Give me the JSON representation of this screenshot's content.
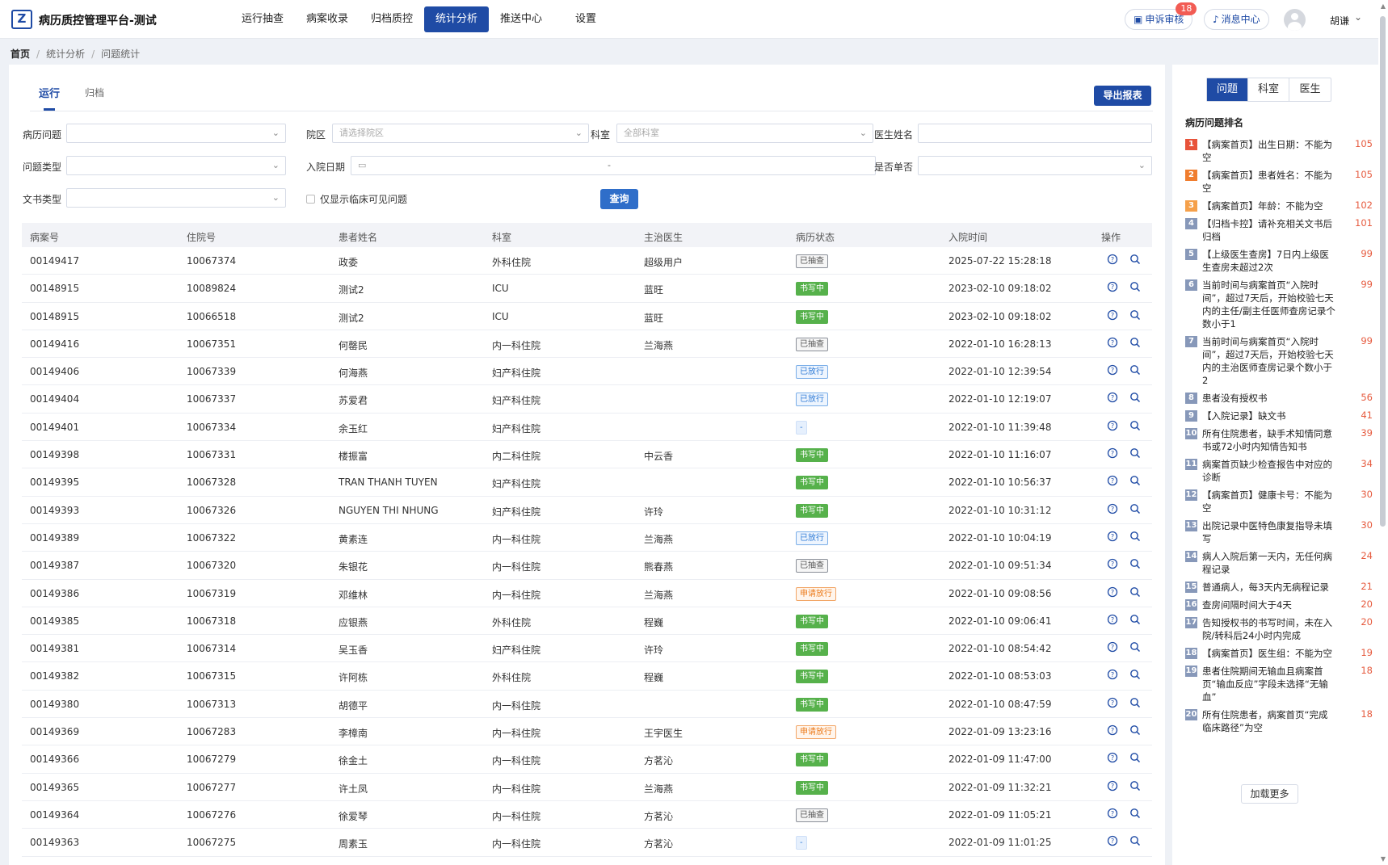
{
  "app": {
    "logo": "Z",
    "title": "病历质控管理平台-测试"
  },
  "nav": [
    "运行抽查",
    "病案收录",
    "归档质控",
    "统计分析",
    "推送中心",
    "设置"
  ],
  "header": {
    "complaint": "申诉审核",
    "complaint_badge": "18",
    "messages": "消息中心",
    "user": "胡谦"
  },
  "breadcrumb": [
    "首页",
    "统计分析",
    "问题统计"
  ],
  "tabs": [
    "运行",
    "归档"
  ],
  "export_label": "导出报表",
  "filters": {
    "record_issue": "病历问题",
    "campus": "院区",
    "campus_placeholder": "请选择院区",
    "dept": "科室",
    "dept_placeholder": "全部科室",
    "doctor": "医生姓名",
    "issue_type": "问题类型",
    "admit_date": "入院日期",
    "date_sep": "-",
    "single_veto": "是否单否",
    "doc_type": "文书类型",
    "clinical_only": "仅显示临床可见问题",
    "query": "查询"
  },
  "columns": [
    "病案号",
    "住院号",
    "患者姓名",
    "科室",
    "主治医生",
    "病历状态",
    "入院时间",
    "操作"
  ],
  "rows": [
    {
      "case": "00149417",
      "inp": "10067374",
      "name": "政委",
      "dept": "外科住院",
      "doc": "超级用户",
      "status": "已抽查",
      "st": "gray",
      "time": "2025-07-22 15:28:18"
    },
    {
      "case": "00148915",
      "inp": "10089824",
      "name": "测试2",
      "dept": "ICU",
      "doc": "蓝旺",
      "status": "书写中",
      "st": "green",
      "time": "2023-02-10 09:18:02"
    },
    {
      "case": "00148915",
      "inp": "10066518",
      "name": "测试2",
      "dept": "ICU",
      "doc": "蓝旺",
      "status": "书写中",
      "st": "green",
      "time": "2023-02-10 09:18:02"
    },
    {
      "case": "00149416",
      "inp": "10067351",
      "name": "何罄民",
      "dept": "内一科住院",
      "doc": "兰海燕",
      "status": "已抽查",
      "st": "gray",
      "time": "2022-01-10 16:28:13"
    },
    {
      "case": "00149406",
      "inp": "10067339",
      "name": "何海燕",
      "dept": "妇产科住院",
      "doc": "",
      "status": "已放行",
      "st": "blue",
      "time": "2022-01-10 12:39:54"
    },
    {
      "case": "00149404",
      "inp": "10067337",
      "name": "苏爱君",
      "dept": "妇产科住院",
      "doc": "",
      "status": "已放行",
      "st": "blue",
      "time": "2022-01-10 12:19:07"
    },
    {
      "case": "00149401",
      "inp": "10067334",
      "name": "余玉红",
      "dept": "妇产科住院",
      "doc": "",
      "status": "-",
      "st": "lblue",
      "time": "2022-01-10 11:39:48"
    },
    {
      "case": "00149398",
      "inp": "10067331",
      "name": "楼振富",
      "dept": "内二科住院",
      "doc": "中云香",
      "status": "书写中",
      "st": "green",
      "time": "2022-01-10 11:16:07"
    },
    {
      "case": "00149395",
      "inp": "10067328",
      "name": "TRAN THANH TUYEN",
      "dept": "妇产科住院",
      "doc": "",
      "status": "书写中",
      "st": "green",
      "time": "2022-01-10 10:56:37"
    },
    {
      "case": "00149393",
      "inp": "10067326",
      "name": "NGUYEN THI NHUNG",
      "dept": "妇产科住院",
      "doc": "许玲",
      "status": "书写中",
      "st": "green",
      "time": "2022-01-10 10:31:12"
    },
    {
      "case": "00149389",
      "inp": "10067322",
      "name": "黄素连",
      "dept": "内一科住院",
      "doc": "兰海燕",
      "status": "已放行",
      "st": "blue",
      "time": "2022-01-10 10:04:19"
    },
    {
      "case": "00149387",
      "inp": "10067320",
      "name": "朱银花",
      "dept": "内一科住院",
      "doc": "熊春燕",
      "status": "已抽查",
      "st": "gray",
      "time": "2022-01-10 09:51:34"
    },
    {
      "case": "00149386",
      "inp": "10067319",
      "name": "邓维林",
      "dept": "内一科住院",
      "doc": "兰海燕",
      "status": "申请放行",
      "st": "orange",
      "time": "2022-01-10 09:08:56"
    },
    {
      "case": "00149385",
      "inp": "10067318",
      "name": "应银燕",
      "dept": "外科住院",
      "doc": "程巍",
      "status": "书写中",
      "st": "green",
      "time": "2022-01-10 09:06:41"
    },
    {
      "case": "00149381",
      "inp": "10067314",
      "name": "吴玉香",
      "dept": "妇产科住院",
      "doc": "许玲",
      "status": "书写中",
      "st": "green",
      "time": "2022-01-10 08:54:42"
    },
    {
      "case": "00149382",
      "inp": "10067315",
      "name": "许阿栋",
      "dept": "外科住院",
      "doc": "程巍",
      "status": "书写中",
      "st": "green",
      "time": "2022-01-10 08:53:03"
    },
    {
      "case": "00149380",
      "inp": "10067313",
      "name": "胡德平",
      "dept": "内一科住院",
      "doc": "",
      "status": "书写中",
      "st": "green",
      "time": "2022-01-10 08:47:59"
    },
    {
      "case": "00149369",
      "inp": "10067283",
      "name": "李樟南",
      "dept": "内一科住院",
      "doc": "王宇医生",
      "status": "申请放行",
      "st": "orange",
      "time": "2022-01-09 13:23:16"
    },
    {
      "case": "00149366",
      "inp": "10067279",
      "name": "徐金土",
      "dept": "内一科住院",
      "doc": "方茗沁",
      "status": "书写中",
      "st": "green",
      "time": "2022-01-09 11:47:00"
    },
    {
      "case": "00149365",
      "inp": "10067277",
      "name": "许土凤",
      "dept": "内一科住院",
      "doc": "兰海燕",
      "status": "书写中",
      "st": "green",
      "time": "2022-01-09 11:32:21"
    },
    {
      "case": "00149364",
      "inp": "10067276",
      "name": "徐爱琴",
      "dept": "内一科住院",
      "doc": "方茗沁",
      "status": "已抽查",
      "st": "gray",
      "time": "2022-01-09 11:05:21"
    },
    {
      "case": "00149363",
      "inp": "10067275",
      "name": "周素玉",
      "dept": "内一科住院",
      "doc": "方茗沁",
      "status": "-",
      "st": "lblue",
      "time": "2022-01-09 11:01:25"
    }
  ],
  "side": {
    "tabs": [
      "问题",
      "科室",
      "医生"
    ],
    "title": "病历问题排名",
    "load_more": "加载更多",
    "rank_colors": [
      "#e8533a",
      "#f07d2e",
      "#f5a04a"
    ],
    "ranking": [
      {
        "n": "1",
        "text": "【病案首页】出生日期：不能为空",
        "count": "105"
      },
      {
        "n": "2",
        "text": "【病案首页】患者姓名：不能为空",
        "count": "105"
      },
      {
        "n": "3",
        "text": "【病案首页】年龄：不能为空",
        "count": "102"
      },
      {
        "n": "4",
        "text": "【归档卡控】请补充相关文书后归档",
        "count": "101"
      },
      {
        "n": "5",
        "text": "【上级医生查房】7日内上级医生查房未超过2次",
        "count": "99"
      },
      {
        "n": "6",
        "text": "当前时间与病案首页“入院时间”，超过7天后，开始校验七天内的主任/副主任医师查房记录个数小于1",
        "count": "99"
      },
      {
        "n": "7",
        "text": "当前时间与病案首页“入院时间”，超过7天后，开始校验七天内的主治医师查房记录个数小于2",
        "count": "99"
      },
      {
        "n": "8",
        "text": "患者没有授权书",
        "count": "56"
      },
      {
        "n": "9",
        "text": "【入院记录】缺文书",
        "count": "41"
      },
      {
        "n": "10",
        "text": "所有住院患者，缺手术知情同意书或72小时内知情告知书",
        "count": "39"
      },
      {
        "n": "11",
        "text": "病案首页缺少检查报告中对应的诊断",
        "count": "34"
      },
      {
        "n": "12",
        "text": "【病案首页】健康卡号：不能为空",
        "count": "30"
      },
      {
        "n": "13",
        "text": "出院记录中医特色康复指导未填写",
        "count": "30"
      },
      {
        "n": "14",
        "text": "病人入院后第一天内，无任何病程记录",
        "count": "24"
      },
      {
        "n": "15",
        "text": "普通病人，每3天内无病程记录",
        "count": "21"
      },
      {
        "n": "16",
        "text": "查房间隔时间大于4天",
        "count": "20"
      },
      {
        "n": "17",
        "text": "告知授权书的书写时间，未在入院/转科后24小时内完成",
        "count": "20"
      },
      {
        "n": "18",
        "text": "【病案首页】医生组：不能为空",
        "count": "19"
      },
      {
        "n": "19",
        "text": "患者住院期间无输血且病案首页“输血反应”字段未选择“无输血”",
        "count": "18"
      },
      {
        "n": "20",
        "text": "所有住院患者，病案首页“完成临床路径”为空",
        "count": "18"
      }
    ]
  }
}
